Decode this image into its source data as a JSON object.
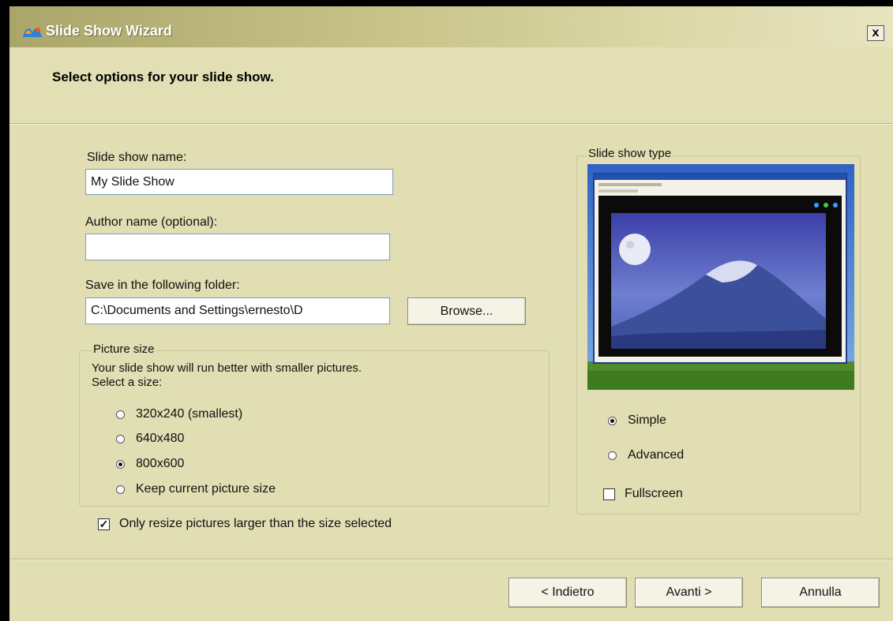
{
  "window": {
    "title": "Slide Show Wizard",
    "close_label": "x",
    "app_icon": "photo-story-icon"
  },
  "header": {
    "text": "Select options for your slide show."
  },
  "form": {
    "name_label": "Slide show name:",
    "name_value": "My Slide Show",
    "author_label": "Author name (optional):",
    "author_value": "",
    "folder_label": "Save in the following folder:",
    "folder_value": "C:\\Documents and Settings\\ernesto\\D",
    "browse_label": "Browse..."
  },
  "picture_size": {
    "legend": "Picture size",
    "hint1": "Your slide show will run better with smaller pictures.",
    "hint2": "Select a size:",
    "options": [
      {
        "label": "320x240 (smallest)",
        "selected": false
      },
      {
        "label": "640x480",
        "selected": false
      },
      {
        "label": "800x600",
        "selected": true
      },
      {
        "label": "Keep current picture size",
        "selected": false
      }
    ]
  },
  "resize_option": {
    "label": "Only resize pictures larger than the size selected",
    "checked": true
  },
  "slideshow_type": {
    "legend": "Slide show type",
    "options": [
      {
        "label": "Simple",
        "selected": true
      },
      {
        "label": "Advanced",
        "selected": false
      }
    ],
    "fullscreen_label": "Fullscreen",
    "fullscreen_checked": false
  },
  "footer": {
    "back_label": "< Indietro",
    "next_label": "Avanti >",
    "cancel_label": "Annulla"
  },
  "colors": {
    "window_bg": "#e0deb2",
    "titlebar": "#aaa66a",
    "sky_preview": "#3a6fd0"
  }
}
